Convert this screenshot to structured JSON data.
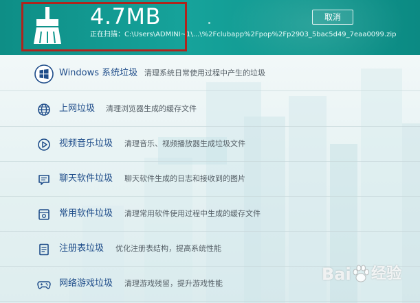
{
  "header": {
    "size": "4.7MB",
    "scan_label": "正在扫描：",
    "scan_path": "C:\\Users\\ADMINI~1\\...\\%2Fclubapp%2Fpop%2Fp2903_5bac5d49_7eaa0099.zip",
    "cancel_label": "取消",
    "icon": "broom-icon"
  },
  "items": [
    {
      "icon": "windows-icon",
      "title": "Windows 系统垃圾",
      "desc": "清理系统日常使用过程中产生的垃圾"
    },
    {
      "icon": "globe-icon",
      "title": "上网垃圾",
      "desc": "清理浏览器生成的缓存文件"
    },
    {
      "icon": "play-icon",
      "title": "视频音乐垃圾",
      "desc": "清理音乐、视频播放器生成垃圾文件"
    },
    {
      "icon": "chat-icon",
      "title": "聊天软件垃圾",
      "desc": "聊天软件生成的日志和接收到的图片"
    },
    {
      "icon": "software-icon",
      "title": "常用软件垃圾",
      "desc": "清理常用软件使用过程中生成的缓存文件"
    },
    {
      "icon": "registry-icon",
      "title": "注册表垃圾",
      "desc": "优化注册表结构，提高系统性能"
    },
    {
      "icon": "gamepad-icon",
      "title": "网络游戏垃圾",
      "desc": "清理游戏残留，提升游戏性能"
    }
  ],
  "watermark": {
    "brand": "Bai",
    "suffix": "经验",
    "icon": "paw-icon"
  },
  "colors": {
    "header": "#119a91",
    "title": "#1f4d8a",
    "highlight_frame": "#b0241c"
  }
}
